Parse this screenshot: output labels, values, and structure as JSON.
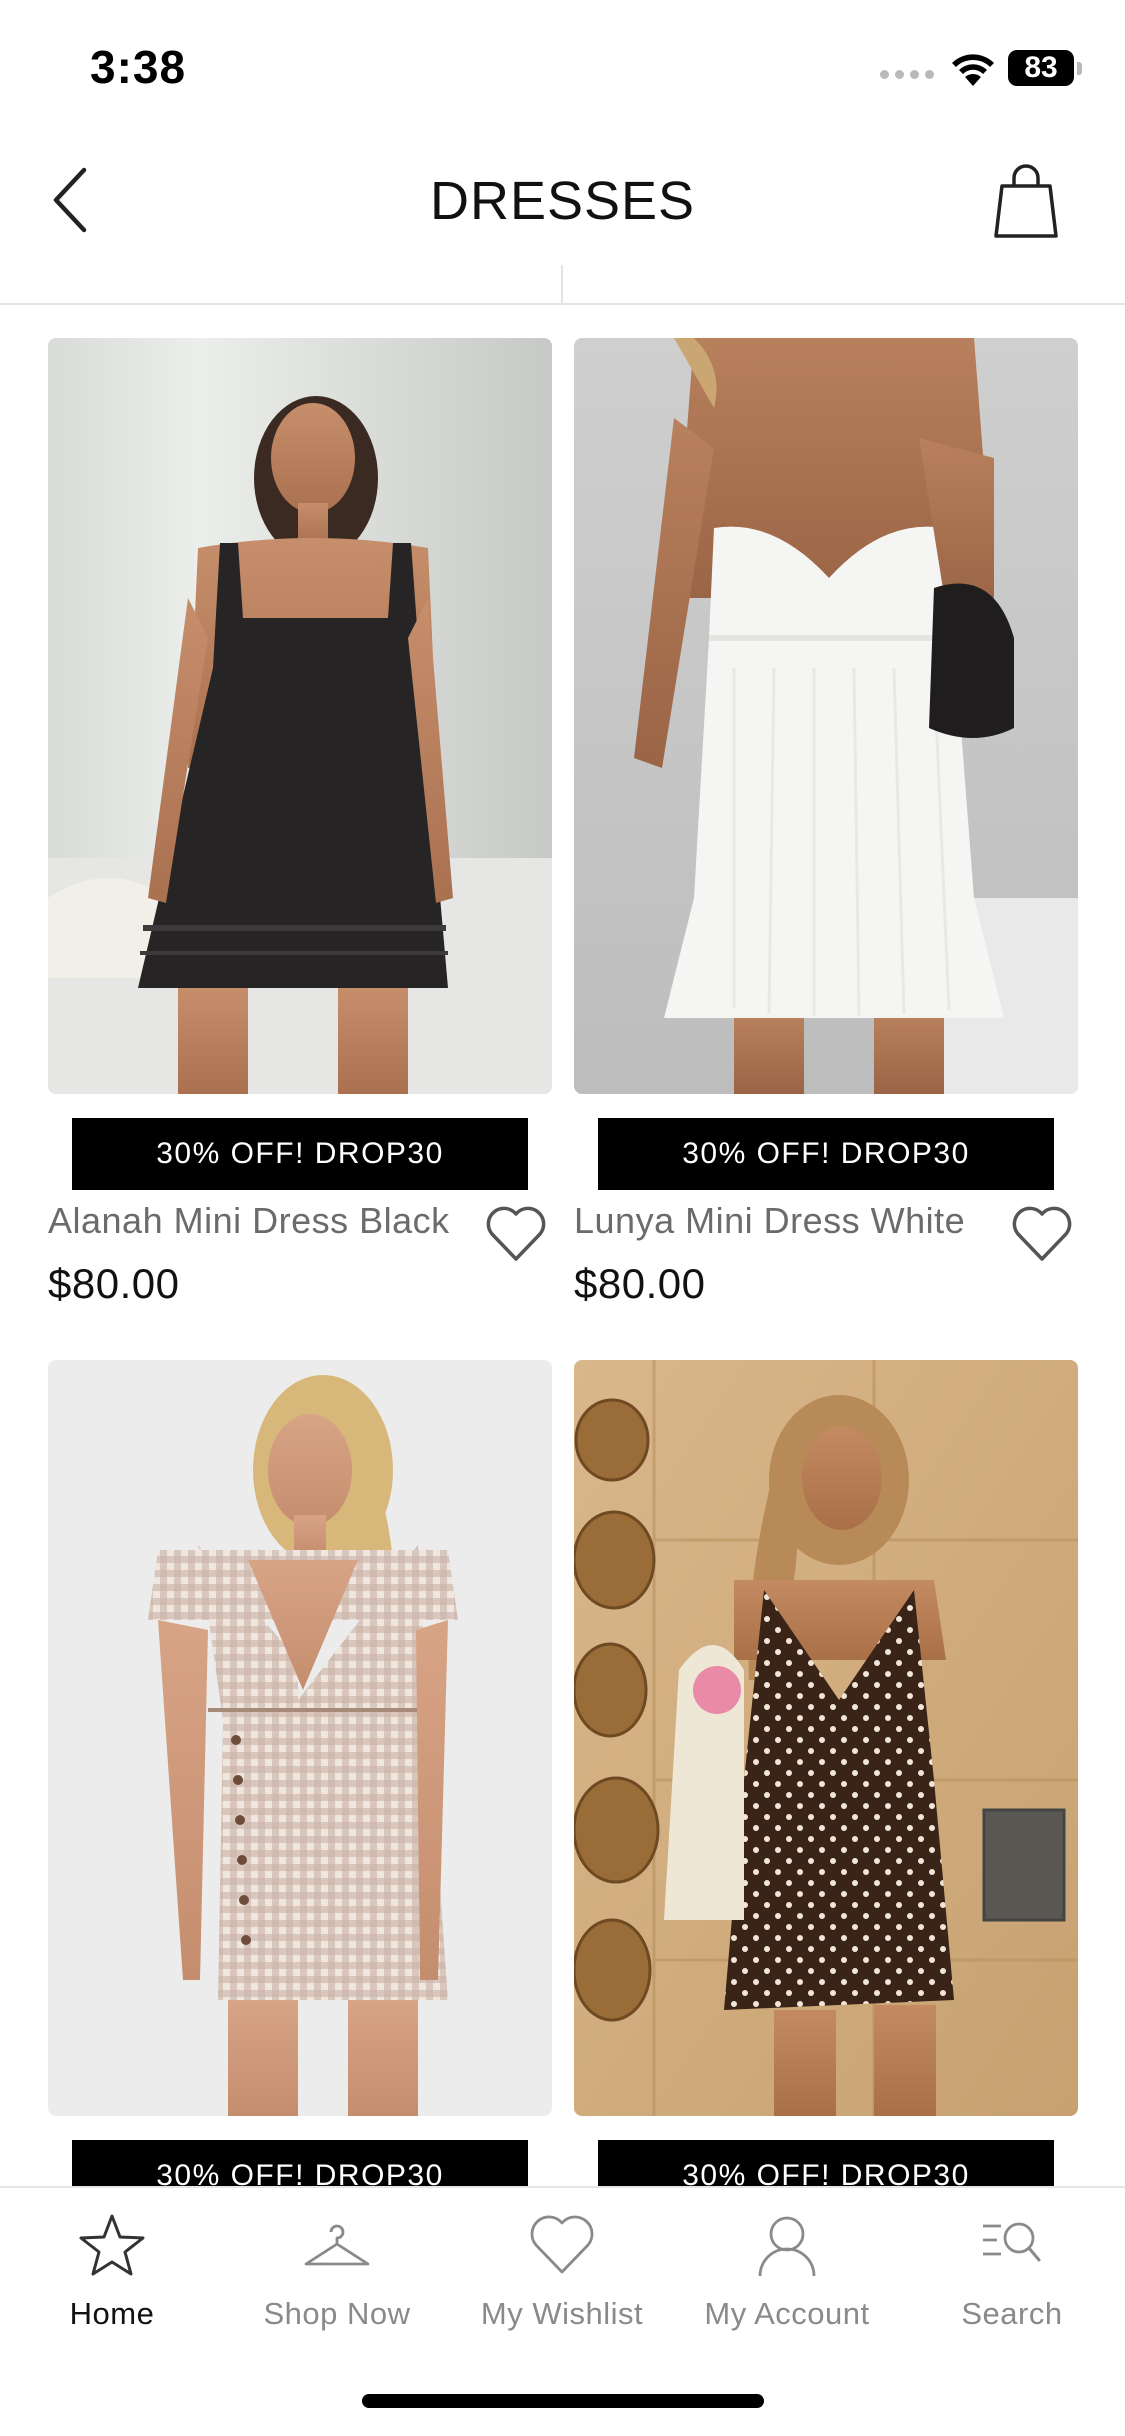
{
  "status_bar": {
    "time": "3:38",
    "battery": "83"
  },
  "header": {
    "title": "DRESSES",
    "back_icon": "chevron-left-icon",
    "bag_icon": "shopping-bag-icon"
  },
  "products": [
    {
      "name": "Alanah Mini Dress Black",
      "price": "$80.00",
      "promo": "30% OFF! DROP30"
    },
    {
      "name": "Lunya Mini Dress White",
      "price": "$80.00",
      "promo": "30% OFF! DROP30"
    },
    {
      "name": "",
      "price": "",
      "promo": "30% OFF! DROP30"
    },
    {
      "name": "",
      "price": "",
      "promo": "30% OFF! DROP30"
    }
  ],
  "tabbar": {
    "items": [
      {
        "label": "Home",
        "icon": "star-icon",
        "active": true
      },
      {
        "label": "Shop Now",
        "icon": "hanger-icon",
        "active": false
      },
      {
        "label": "My Wishlist",
        "icon": "heart-icon",
        "active": false
      },
      {
        "label": "My Account",
        "icon": "user-icon",
        "active": false
      },
      {
        "label": "Search",
        "icon": "search-icon",
        "active": false
      }
    ]
  },
  "colors": {
    "promo_bg": "#000000",
    "active_tab": "#111111",
    "inactive_tab": "#8a8a8a"
  }
}
